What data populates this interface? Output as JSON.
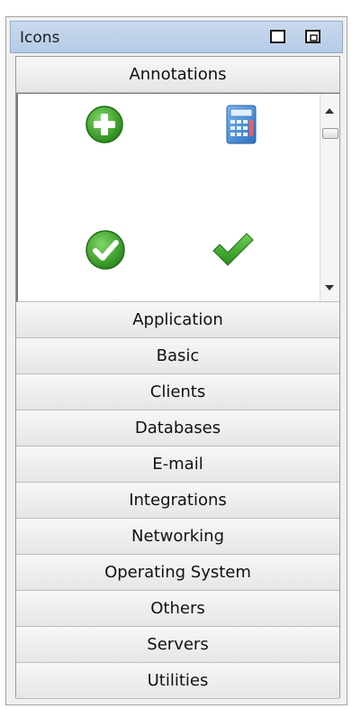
{
  "window": {
    "title": "Icons"
  },
  "categories": {
    "annotations": "Annotations",
    "application": "Application",
    "basic": "Basic",
    "clients": "Clients",
    "databases": "Databases",
    "email": "E-mail",
    "integrations": "Integrations",
    "networking": "Networking",
    "operating_system": "Operating System",
    "others": "Others",
    "servers": "Servers",
    "utilities": "Utilities"
  },
  "icons": {
    "items": [
      "add-circle-icon",
      "calculator-icon",
      "check-circle-icon",
      "checkmark-icon"
    ]
  },
  "colors": {
    "title_bar": "#c9d9ee",
    "icon_green": "#3aa327",
    "calculator_blue": "#4a90d9"
  }
}
